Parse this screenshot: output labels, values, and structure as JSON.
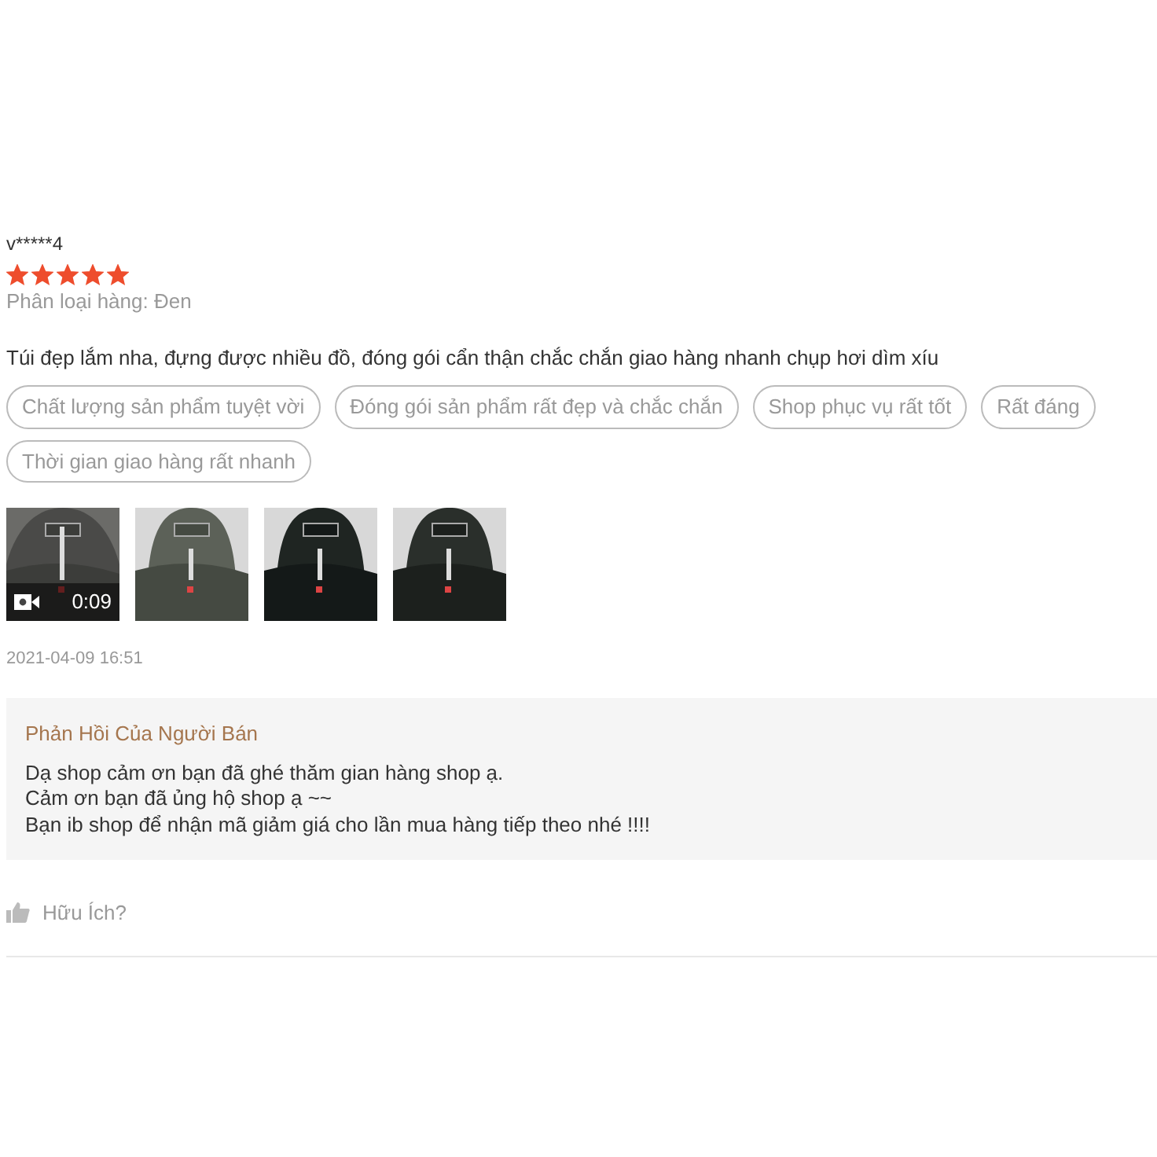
{
  "review": {
    "username": "v*****4",
    "stars": 5,
    "variation": "Phân loại hàng: Đen",
    "comment": "Túi đẹp lắm nha, đựng được nhiều đồ, đóng gói cẩn thận chắc chắn giao hàng nhanh chụp hơi dìm xíu",
    "tags": [
      "Chất lượng sản phẩm tuyệt vời",
      "Đóng gói sản phẩm rất đẹp và chắc chắn",
      "Shop phục vụ rất tốt",
      "Rất đáng",
      "Thời gian giao hàng rất nhanh"
    ],
    "media": [
      {
        "kind": "video",
        "duration": "0:09"
      },
      {
        "kind": "picture"
      },
      {
        "kind": "picture"
      },
      {
        "kind": "picture"
      }
    ],
    "date": "2021-04-09 16:51",
    "seller_reply": {
      "title": "Phản Hồi Của Người Bán",
      "lines": [
        "Dạ shop cảm ơn bạn đã ghé thăm gian hàng shop ạ.",
        "Cảm ơn bạn đã ủng hộ shop ạ ~~",
        "Bạn ib shop để nhận mã giảm giá cho lần mua hàng tiếp theo nhé !!!!"
      ]
    },
    "helpful": "Hữu Ích?"
  }
}
